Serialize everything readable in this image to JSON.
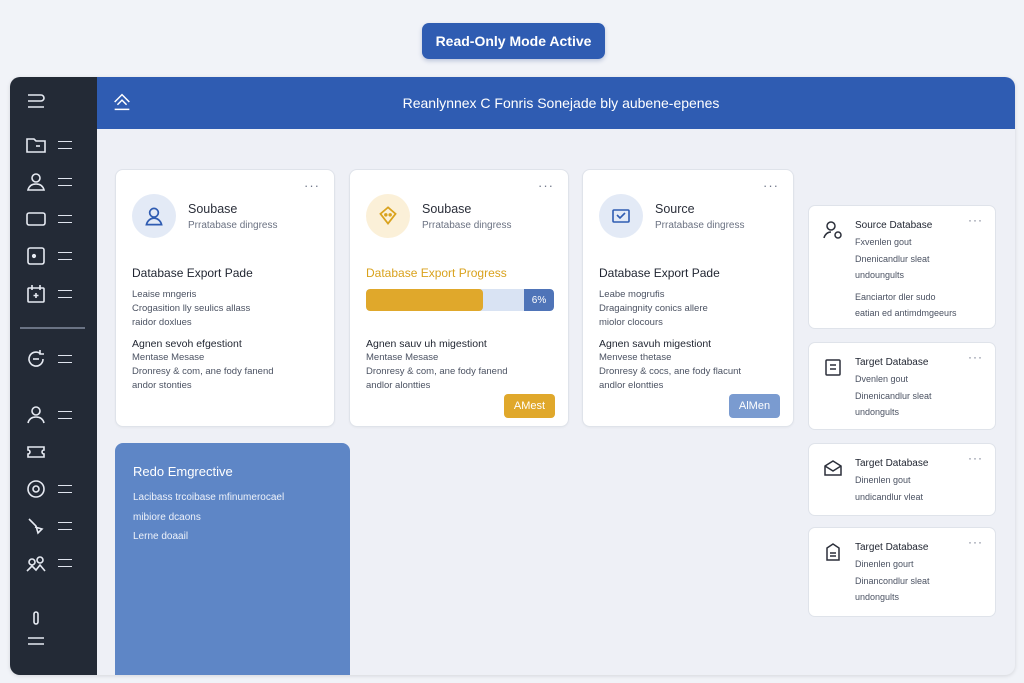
{
  "mode_button": "Read-Only Mode Active",
  "header": {
    "title": "Reanlynnex C Fonris Sonejade bly aubene-epenes"
  },
  "cards": [
    {
      "name": "Soubase",
      "subtitle": "Prratabase dingress",
      "dots": "···",
      "heading": "Database Export Pade",
      "lines": [
        "Leaise mngeris",
        "Crogasition lly seulics allass",
        "raidor doxlues"
      ],
      "section": "Agnen sevoh efgestiont",
      "sec_lines": [
        "Mentase Mesase",
        "Dronresy & com, ane fody fanend",
        "andor stonties"
      ]
    },
    {
      "name": "Soubase",
      "subtitle": "Prratabase dingress",
      "dots": "···",
      "heading": "Database Export Progress",
      "progress": {
        "value": 0.62,
        "label": "6%"
      },
      "section": "Agnen sauv uh migestiont",
      "sec_lines": [
        "Mentase Mesase",
        "Dronresy & com, ane fody fanend",
        "andlor alontties"
      ],
      "button": "AMest"
    },
    {
      "name": "Source",
      "subtitle": "Prratabase dingress",
      "dots": "···",
      "heading": "Database Export Pade",
      "lines": [
        "Leabe mogrufis",
        "Dragaingnity conics allere",
        "miolor clocours"
      ],
      "section": "Agnen savuh migestiont",
      "sec_lines": [
        "Menvese thetase",
        "Dronresy & cocs, ane fody flacunt",
        "andlor elontties"
      ],
      "button": "AlMen"
    }
  ],
  "left_panel": {
    "title": "Redo Emgrective",
    "lines": [
      "Lacibass trcoibase mfinumerocael",
      "mibiore dcaons",
      "Lerne doaail"
    ]
  },
  "right_cards": [
    {
      "title": "Source Database",
      "dots": "···",
      "lines": [
        "Fxvenlen gout",
        "Dnenicandlur sleat",
        "undoungults",
        "Eanciartor dler sudo",
        "eatian ed antimdmgeeurs"
      ]
    },
    {
      "title": "Target Database",
      "dots": "···",
      "lines": [
        "Dvenlen gout",
        "Dinenicandlur sleat",
        "undongults"
      ]
    },
    {
      "title": "Target Database",
      "dots": "···",
      "lines": [
        "Dinenlen gout",
        "undicandlur vleat"
      ]
    },
    {
      "title": "Target Database",
      "dots": "···",
      "lines": [
        "Dinenlen gourt",
        "Dinancondlur sleat",
        "undongults"
      ]
    }
  ],
  "colors": {
    "primary": "#2f5cb2",
    "sidebar": "#232a36",
    "accent_yellow": "#e0a82b",
    "panel_blue": "#5e86c6"
  },
  "icons": [
    "menu-icon",
    "folder-icon",
    "user-icon",
    "monitor-icon",
    "image-icon",
    "calendar-icon",
    "refresh-icon",
    "profile-icon",
    "ticket-icon",
    "support-icon",
    "tool-icon",
    "people-icon",
    "mobile-icon",
    "hamburger-icon"
  ]
}
